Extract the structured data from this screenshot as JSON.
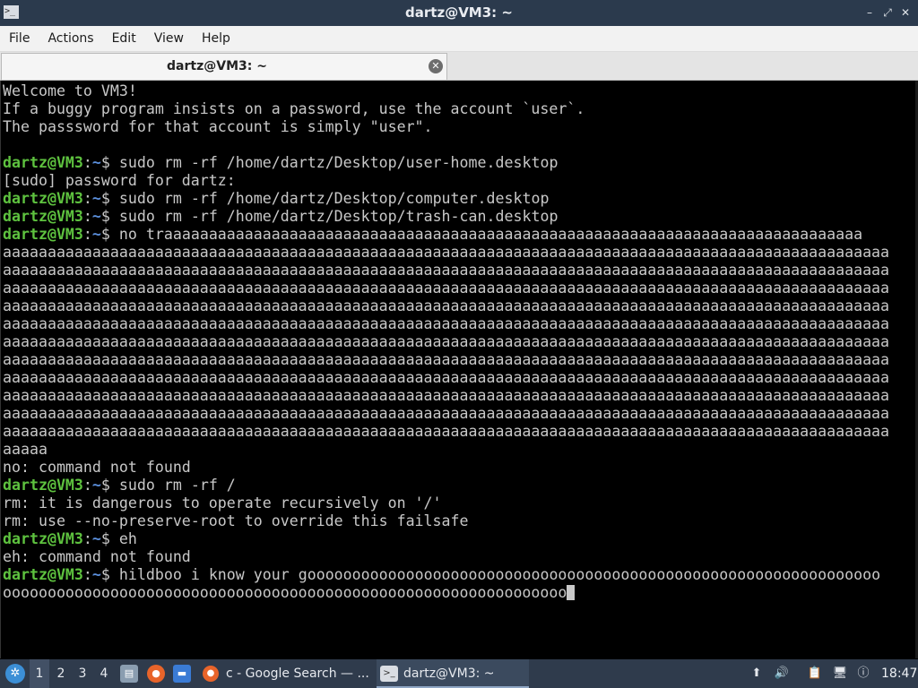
{
  "window": {
    "title": "dartz@VM3: ~",
    "icon": "terminal-icon",
    "minimize": "–",
    "maximize": "⤢",
    "close": "✕"
  },
  "menu": [
    "File",
    "Actions",
    "Edit",
    "View",
    "Help"
  ],
  "tab": {
    "label": "dartz@VM3: ~",
    "close": "✕"
  },
  "terminal": {
    "lines": [
      {
        "type": "text",
        "text": "Welcome to VM3!"
      },
      {
        "type": "text",
        "text": "If a buggy program insists on a password, use the account `user`."
      },
      {
        "type": "text",
        "text": "The passsword for that account is simply \"user\"."
      },
      {
        "type": "text",
        "text": ""
      },
      {
        "type": "prompt",
        "user": "dartz@VM3",
        "colon": ":",
        "path": "~",
        "sym": "$",
        "cmd": " sudo rm -rf /home/dartz/Desktop/user-home.desktop"
      },
      {
        "type": "text",
        "text": "[sudo] password for dartz:"
      },
      {
        "type": "prompt",
        "user": "dartz@VM3",
        "colon": ":",
        "path": "~",
        "sym": "$",
        "cmd": " sudo rm -rf /home/dartz/Desktop/computer.desktop"
      },
      {
        "type": "prompt",
        "user": "dartz@VM3",
        "colon": ":",
        "path": "~",
        "sym": "$",
        "cmd": " sudo rm -rf /home/dartz/Desktop/trash-can.desktop"
      },
      {
        "type": "prompt",
        "user": "dartz@VM3",
        "colon": ":",
        "path": "~",
        "sym": "$",
        "cmd": " no traaaaaaaaaaaaaaaaaaaaaaaaaaaaaaaaaaaaaaaaaaaaaaaaaaaaaaaaaaaaaaaaaaaaaaaaaaaaaa"
      },
      {
        "type": "text",
        "text": "aaaaaaaaaaaaaaaaaaaaaaaaaaaaaaaaaaaaaaaaaaaaaaaaaaaaaaaaaaaaaaaaaaaaaaaaaaaaaaaaaaaaaaaaaaaaaaaaaaa"
      },
      {
        "type": "text",
        "text": "aaaaaaaaaaaaaaaaaaaaaaaaaaaaaaaaaaaaaaaaaaaaaaaaaaaaaaaaaaaaaaaaaaaaaaaaaaaaaaaaaaaaaaaaaaaaaaaaaaa"
      },
      {
        "type": "text",
        "text": "aaaaaaaaaaaaaaaaaaaaaaaaaaaaaaaaaaaaaaaaaaaaaaaaaaaaaaaaaaaaaaaaaaaaaaaaaaaaaaaaaaaaaaaaaaaaaaaaaaa"
      },
      {
        "type": "text",
        "text": "aaaaaaaaaaaaaaaaaaaaaaaaaaaaaaaaaaaaaaaaaaaaaaaaaaaaaaaaaaaaaaaaaaaaaaaaaaaaaaaaaaaaaaaaaaaaaaaaaaa"
      },
      {
        "type": "text",
        "text": "aaaaaaaaaaaaaaaaaaaaaaaaaaaaaaaaaaaaaaaaaaaaaaaaaaaaaaaaaaaaaaaaaaaaaaaaaaaaaaaaaaaaaaaaaaaaaaaaaaa"
      },
      {
        "type": "text",
        "text": "aaaaaaaaaaaaaaaaaaaaaaaaaaaaaaaaaaaaaaaaaaaaaaaaaaaaaaaaaaaaaaaaaaaaaaaaaaaaaaaaaaaaaaaaaaaaaaaaaaa"
      },
      {
        "type": "text",
        "text": "aaaaaaaaaaaaaaaaaaaaaaaaaaaaaaaaaaaaaaaaaaaaaaaaaaaaaaaaaaaaaaaaaaaaaaaaaaaaaaaaaaaaaaaaaaaaaaaaaaa"
      },
      {
        "type": "text",
        "text": "aaaaaaaaaaaaaaaaaaaaaaaaaaaaaaaaaaaaaaaaaaaaaaaaaaaaaaaaaaaaaaaaaaaaaaaaaaaaaaaaaaaaaaaaaaaaaaaaaaa"
      },
      {
        "type": "text",
        "text": "aaaaaaaaaaaaaaaaaaaaaaaaaaaaaaaaaaaaaaaaaaaaaaaaaaaaaaaaaaaaaaaaaaaaaaaaaaaaaaaaaaaaaaaaaaaaaaaaaaa"
      },
      {
        "type": "text",
        "text": "aaaaaaaaaaaaaaaaaaaaaaaaaaaaaaaaaaaaaaaaaaaaaaaaaaaaaaaaaaaaaaaaaaaaaaaaaaaaaaaaaaaaaaaaaaaaaaaaaaa"
      },
      {
        "type": "text",
        "text": "aaaaaaaaaaaaaaaaaaaaaaaaaaaaaaaaaaaaaaaaaaaaaaaaaaaaaaaaaaaaaaaaaaaaaaaaaaaaaaaaaaaaaaaaaaaaaaaaaaa"
      },
      {
        "type": "text",
        "text": "aaaaa"
      },
      {
        "type": "text",
        "text": "no: command not found"
      },
      {
        "type": "prompt",
        "user": "dartz@VM3",
        "colon": ":",
        "path": "~",
        "sym": "$",
        "cmd": " sudo rm -rf /"
      },
      {
        "type": "text",
        "text": "rm: it is dangerous to operate recursively on '/'"
      },
      {
        "type": "text",
        "text": "rm: use --no-preserve-root to override this failsafe"
      },
      {
        "type": "prompt",
        "user": "dartz@VM3",
        "colon": ":",
        "path": "~",
        "sym": "$",
        "cmd": " eh"
      },
      {
        "type": "text",
        "text": "eh: command not found"
      },
      {
        "type": "prompt",
        "user": "dartz@VM3",
        "colon": ":",
        "path": "~",
        "sym": "$",
        "cmd": " hildboo i know your goooooooooooooooooooooooooooooooooooooooooooooooooooooooooooooooo"
      },
      {
        "type": "input",
        "text": "ooooooooooooooooooooooooooooooooooooooooooooooooooooooooooooooo"
      }
    ],
    "colors": {
      "user": "#5ec23f",
      "path": "#5b8fdc",
      "text": "#c8c8c8",
      "bg": "#000000"
    }
  },
  "taskbar": {
    "start_icon": "lubuntu-start-icon",
    "workspaces": [
      "1",
      "2",
      "3",
      "4"
    ],
    "active_workspace": "1",
    "windows": [
      {
        "label": "c - Google Search — ...",
        "icon": "firefox-icon"
      },
      {
        "label": "dartz@VM3: ~",
        "icon": "terminal-icon"
      }
    ],
    "clock": "18:47"
  }
}
